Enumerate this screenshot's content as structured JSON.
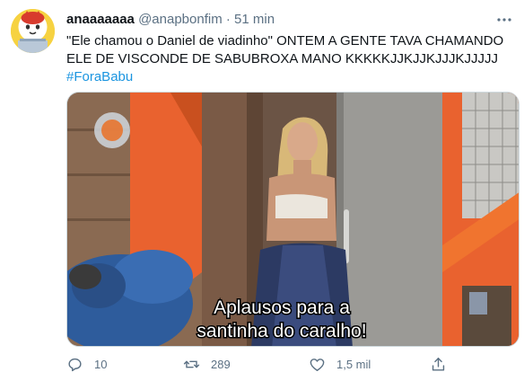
{
  "tweet": {
    "display_name": "anaaaaaaa",
    "handle": "@anapbonfim",
    "separator": "·",
    "time": "51 min",
    "text_main": "\"Ele chamou o Daniel de viadinho\" ONTEM A GENTE TAVA CHAMANDO ELE DE VISCONDE DE SABUBROXA MANO KKKKKJJKJJKJJJKJJJJJ",
    "hashtag": "#ForaBabu"
  },
  "media": {
    "caption_line1": "Aplausos para a",
    "caption_line2": "santinha do caralho!"
  },
  "actions": {
    "reply_count": "10",
    "retweet_count": "289",
    "like_count": "1,5 mil"
  },
  "icons": {
    "more": "more-icon",
    "reply": "reply-icon",
    "retweet": "retweet-icon",
    "like": "like-icon",
    "share": "share-icon"
  },
  "colors": {
    "text": "#0f1419",
    "secondary": "#5b7083",
    "link": "#1b95e0",
    "wall_orange": "#e9622f"
  }
}
